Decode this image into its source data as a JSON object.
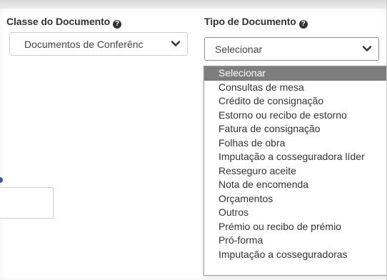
{
  "classe": {
    "label": "Classe do Documento",
    "value": "Documentos de Conferênc"
  },
  "tipo": {
    "label": "Tipo de Documento",
    "value": "Selecionar",
    "options": [
      "Selecionar",
      "Consultas de mesa",
      "Crédito de consignação",
      "Estorno ou recibo de estorno",
      "Fatura de consignação",
      "Folhas de obra",
      "Imputação a cosseguradora líder",
      "Resseguro aceite",
      "Nota de encomenda",
      "Orçamentos",
      "Outros",
      "Prémio ou recibo de prémio",
      "Pró-forma",
      "Imputação a cosseguradoras"
    ],
    "selected_index": 0
  },
  "icons": {
    "help": "question-circle-icon",
    "chevron": "chevron-down-icon"
  }
}
